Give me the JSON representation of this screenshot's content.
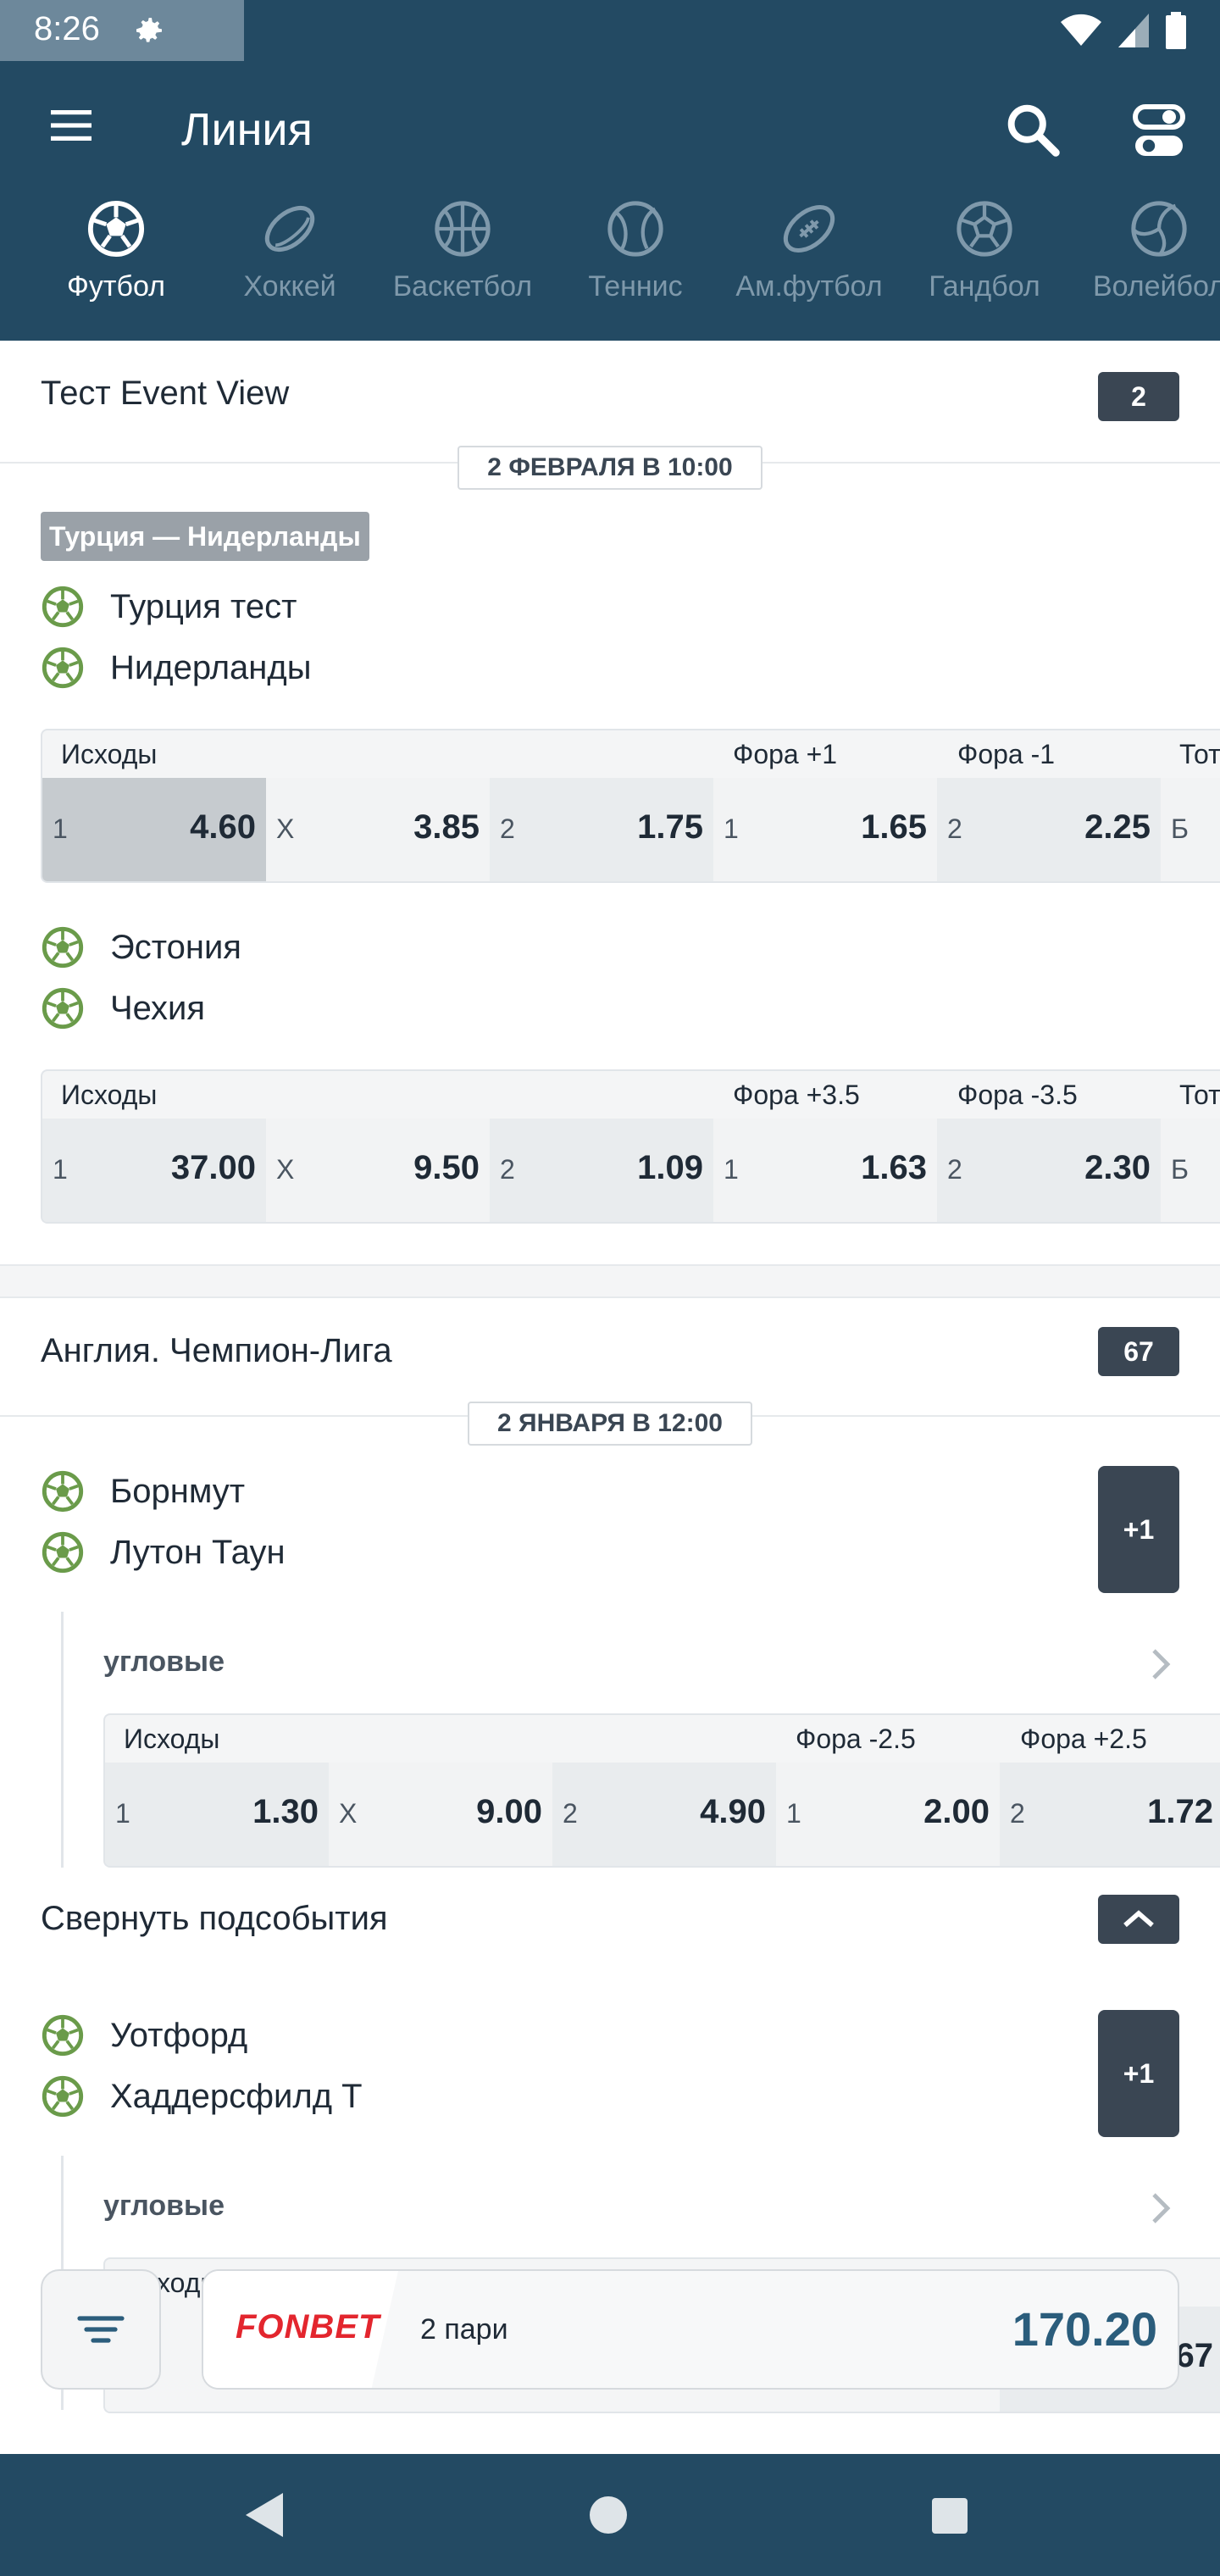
{
  "status_bar": {
    "time": "8:26"
  },
  "header": {
    "title": "Линия"
  },
  "tabs": [
    {
      "label": "Футбол",
      "icon": "soccer-ball-icon",
      "active": true
    },
    {
      "label": "Хоккей",
      "icon": "hockey-puck-icon"
    },
    {
      "label": "Баскетбол",
      "icon": "basketball-icon"
    },
    {
      "label": "Теннис",
      "icon": "tennis-ball-icon"
    },
    {
      "label": "Ам.футбол",
      "icon": "american-football-icon"
    },
    {
      "label": "Гандбол",
      "icon": "handball-icon"
    },
    {
      "label": "Волейбол",
      "icon": "volleyball-icon"
    }
  ],
  "sections": [
    {
      "title": "Тест Event View",
      "count": "2",
      "date": "2 ФЕВРАЛЯ В 10:00",
      "league_tag": "Турция — Нидерланды",
      "events": [
        {
          "teams": [
            "Турция тест",
            "Нидерланды"
          ],
          "markets": {
            "h1": "Исходы",
            "h2": "Фора +1",
            "h3": "Фора -1",
            "h4": "Тот"
          },
          "odds": [
            {
              "label": "1",
              "value": "4.60"
            },
            {
              "label": "X",
              "value": "3.85"
            },
            {
              "label": "2",
              "value": "1.75"
            },
            {
              "label": "1",
              "value": "1.65"
            },
            {
              "label": "2",
              "value": "2.25"
            },
            {
              "label": "Б",
              "value": ""
            }
          ]
        },
        {
          "teams": [
            "Эстония",
            "Чехия"
          ],
          "markets": {
            "h1": "Исходы",
            "h2": "Фора +3.5",
            "h3": "Фора -3.5",
            "h4": "Тот"
          },
          "odds": [
            {
              "label": "1",
              "value": "37.00"
            },
            {
              "label": "X",
              "value": "9.50"
            },
            {
              "label": "2",
              "value": "1.09"
            },
            {
              "label": "1",
              "value": "1.63"
            },
            {
              "label": "2",
              "value": "2.30"
            },
            {
              "label": "Б",
              "value": ""
            }
          ]
        }
      ]
    },
    {
      "title": "Англия. Чемпион-Лига",
      "count": "67",
      "date": "2 ЯНВАРЯ В 12:00",
      "events": [
        {
          "teams": [
            "Борнмут",
            "Лутон Таун"
          ],
          "more": "+1",
          "sub_label": "угловые",
          "markets": {
            "h1": "Исходы",
            "h2": "Фора -2.5",
            "h3": "Фора +2.5"
          },
          "odds": [
            {
              "label": "1",
              "value": "1.30"
            },
            {
              "label": "X",
              "value": "9.00"
            },
            {
              "label": "2",
              "value": "4.90"
            },
            {
              "label": "1",
              "value": "2.00"
            },
            {
              "label": "2",
              "value": "1.72"
            }
          ]
        },
        {
          "teams": [
            "Уотфорд",
            "Хаддерсфилд Т"
          ],
          "more": "+1",
          "sub_label": "угловые",
          "markets": {
            "h1": "Исходы"
          },
          "peek_value": "67"
        }
      ]
    }
  ],
  "collapse_label": "Свернуть подсобытия",
  "coupon": {
    "brand": "FONBET",
    "count_text": "2 пари",
    "total": "170.20"
  },
  "colors": {
    "header": "#234a63",
    "badge": "#3a4653",
    "accent": "#2b5d7c",
    "brand_red": "#e3262e",
    "ball_green": "#6a9b4a"
  }
}
